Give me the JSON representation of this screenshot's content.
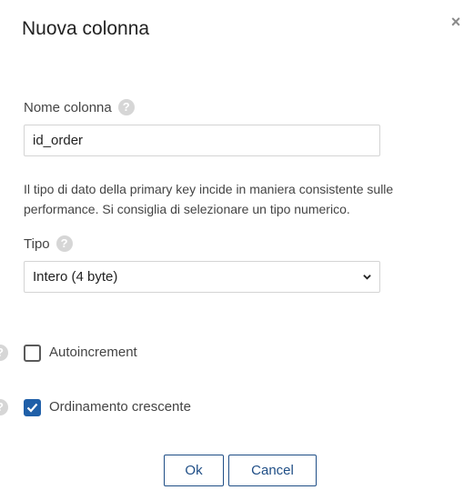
{
  "dialog": {
    "title": "Nuova colonna",
    "close_icon": "×"
  },
  "column_name": {
    "label": "Nome colonna",
    "help_icon": "?",
    "value": "id_order"
  },
  "info_text": "Il tipo di dato della primary key incide in maniera consistente sulle performance. Si consiglia di selezionare un tipo numerico.",
  "type": {
    "label": "Tipo",
    "help_icon": "?",
    "selected": "Intero (4 byte)"
  },
  "options": [
    {
      "label": "Autoincrement",
      "checked": false,
      "help_icon": "?"
    },
    {
      "label": "Ordinamento crescente",
      "checked": true,
      "help_icon": "?"
    }
  ],
  "buttons": {
    "ok": "Ok",
    "cancel": "Cancel"
  },
  "colors": {
    "accent": "#1f5fa8",
    "button_border": "#1f4e86"
  }
}
